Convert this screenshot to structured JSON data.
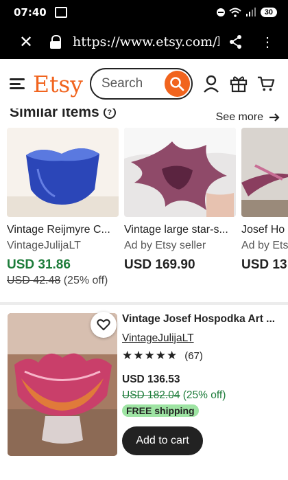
{
  "status": {
    "time": "07:40",
    "battery": "30"
  },
  "browser": {
    "url": "https://www.etsy.com/listi"
  },
  "header": {
    "logo": "Etsy",
    "search_placeholder": "Search"
  },
  "similar": {
    "title": "Similar items",
    "see_more": "See more",
    "items": [
      {
        "title": "Vintage Reijmyre C...",
        "shop": "VintageJulijaLT",
        "price": "USD 31.86",
        "original_price": "USD 42.48",
        "discount": " (25% off)"
      },
      {
        "title": "Vintage large star-s...",
        "shop": "Ad by Etsy seller",
        "price": "USD 169.90"
      },
      {
        "title": "Josef Ho",
        "shop": "Ad by Ets",
        "price": "USD 13"
      }
    ]
  },
  "listing": {
    "title": "Vintage Josef Hospodka Art ...",
    "shop": "VintageJulijaLT",
    "stars": "★★★★★",
    "rating_count": "(67)",
    "price": "USD 136.53",
    "original_price": "USD 182.04",
    "discount": " (25% off)",
    "shipping_badge": "FREE shipping",
    "cart_button": "Add to cart"
  }
}
